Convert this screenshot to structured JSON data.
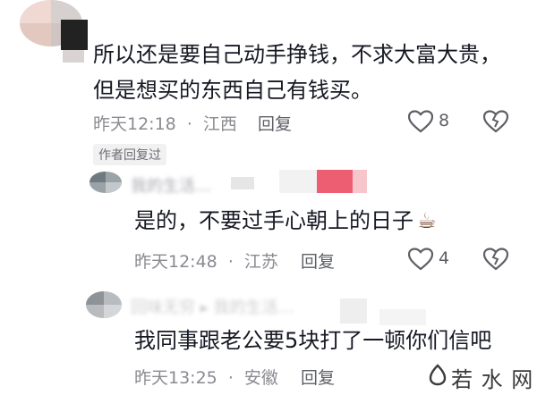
{
  "comments": [
    {
      "text_line1": "所以还是要自己动手挣钱，不求大富大贵，",
      "text_line2": "但是想买的东西自己有钱买。",
      "time": "昨天12:18",
      "location": "江西",
      "reply_label": "回复",
      "likes": "8",
      "badge": "作者回复过"
    },
    {
      "nickname": "我的生活…",
      "text": "是的，不要过手心朝上的日子",
      "emoji": "☕",
      "time": "昨天12:48",
      "location": "江苏",
      "reply_label": "回复",
      "likes": "4"
    },
    {
      "nickname": "回味无穷 ▸ 我的生活…",
      "text": "我同事跟老公要5块打了一顿你们信吧",
      "time": "昨天13:25",
      "location": "安徽",
      "reply_label": "回复"
    }
  ],
  "separator": "·",
  "watermark": "若 水 网",
  "icons": [
    "heart-icon",
    "dislike-icon"
  ],
  "colors": {
    "text": "#161823",
    "meta": "#8a8b91",
    "badge_bg": "#f1f1f2",
    "watermark": "#3b3b3b"
  }
}
